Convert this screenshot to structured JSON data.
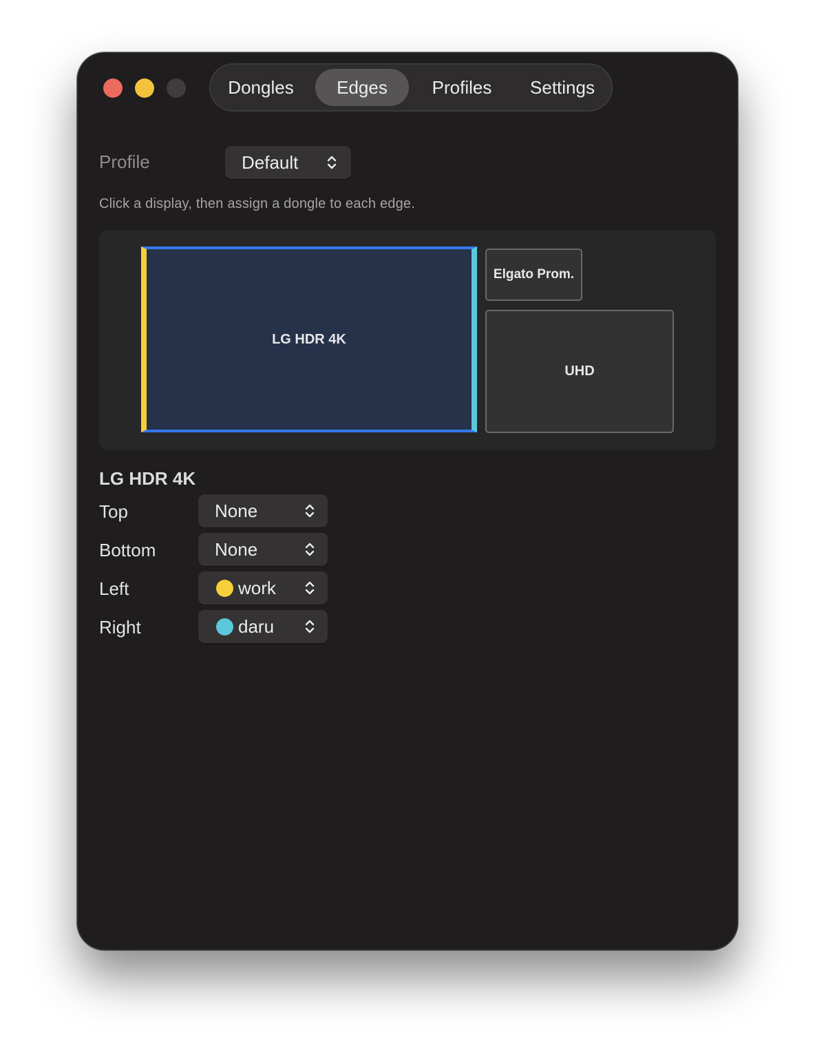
{
  "window": {
    "traffic_lights": [
      {
        "name": "close",
        "color": "#ec6a5e"
      },
      {
        "name": "minimize",
        "color": "#f5c33b"
      },
      {
        "name": "zoom",
        "color": "#3e3c3d"
      }
    ]
  },
  "tabs": {
    "dongles": "Dongles",
    "edges": "Edges",
    "profiles": "Profiles",
    "settings": "Settings",
    "selected": "Edges"
  },
  "profile": {
    "label": "Profile",
    "value": "Default",
    "icon": "chevron-up-down-icon"
  },
  "hint": "Click a display, then assign a dongle to each edge.",
  "arrangement": {
    "displays": [
      {
        "name": "LG HDR 4K",
        "selected": true,
        "fill": "#26324a",
        "selection_color": "#3478ed"
      },
      {
        "name": "Elgato Prom.",
        "selected": false
      },
      {
        "name": "UHD",
        "selected": false
      }
    ],
    "edge_colors": {
      "left": "#f7cf3a",
      "right": "#5bc8dc"
    }
  },
  "edges": {
    "title": "LG HDR 4K",
    "top": {
      "label": "Top",
      "value": "None"
    },
    "bottom": {
      "label": "Bottom",
      "value": "None"
    },
    "left": {
      "label": "Left",
      "value": "work",
      "color": "#f7cf3a"
    },
    "right": {
      "label": "Right",
      "value": "daru",
      "color": "#5bc8dc"
    }
  }
}
